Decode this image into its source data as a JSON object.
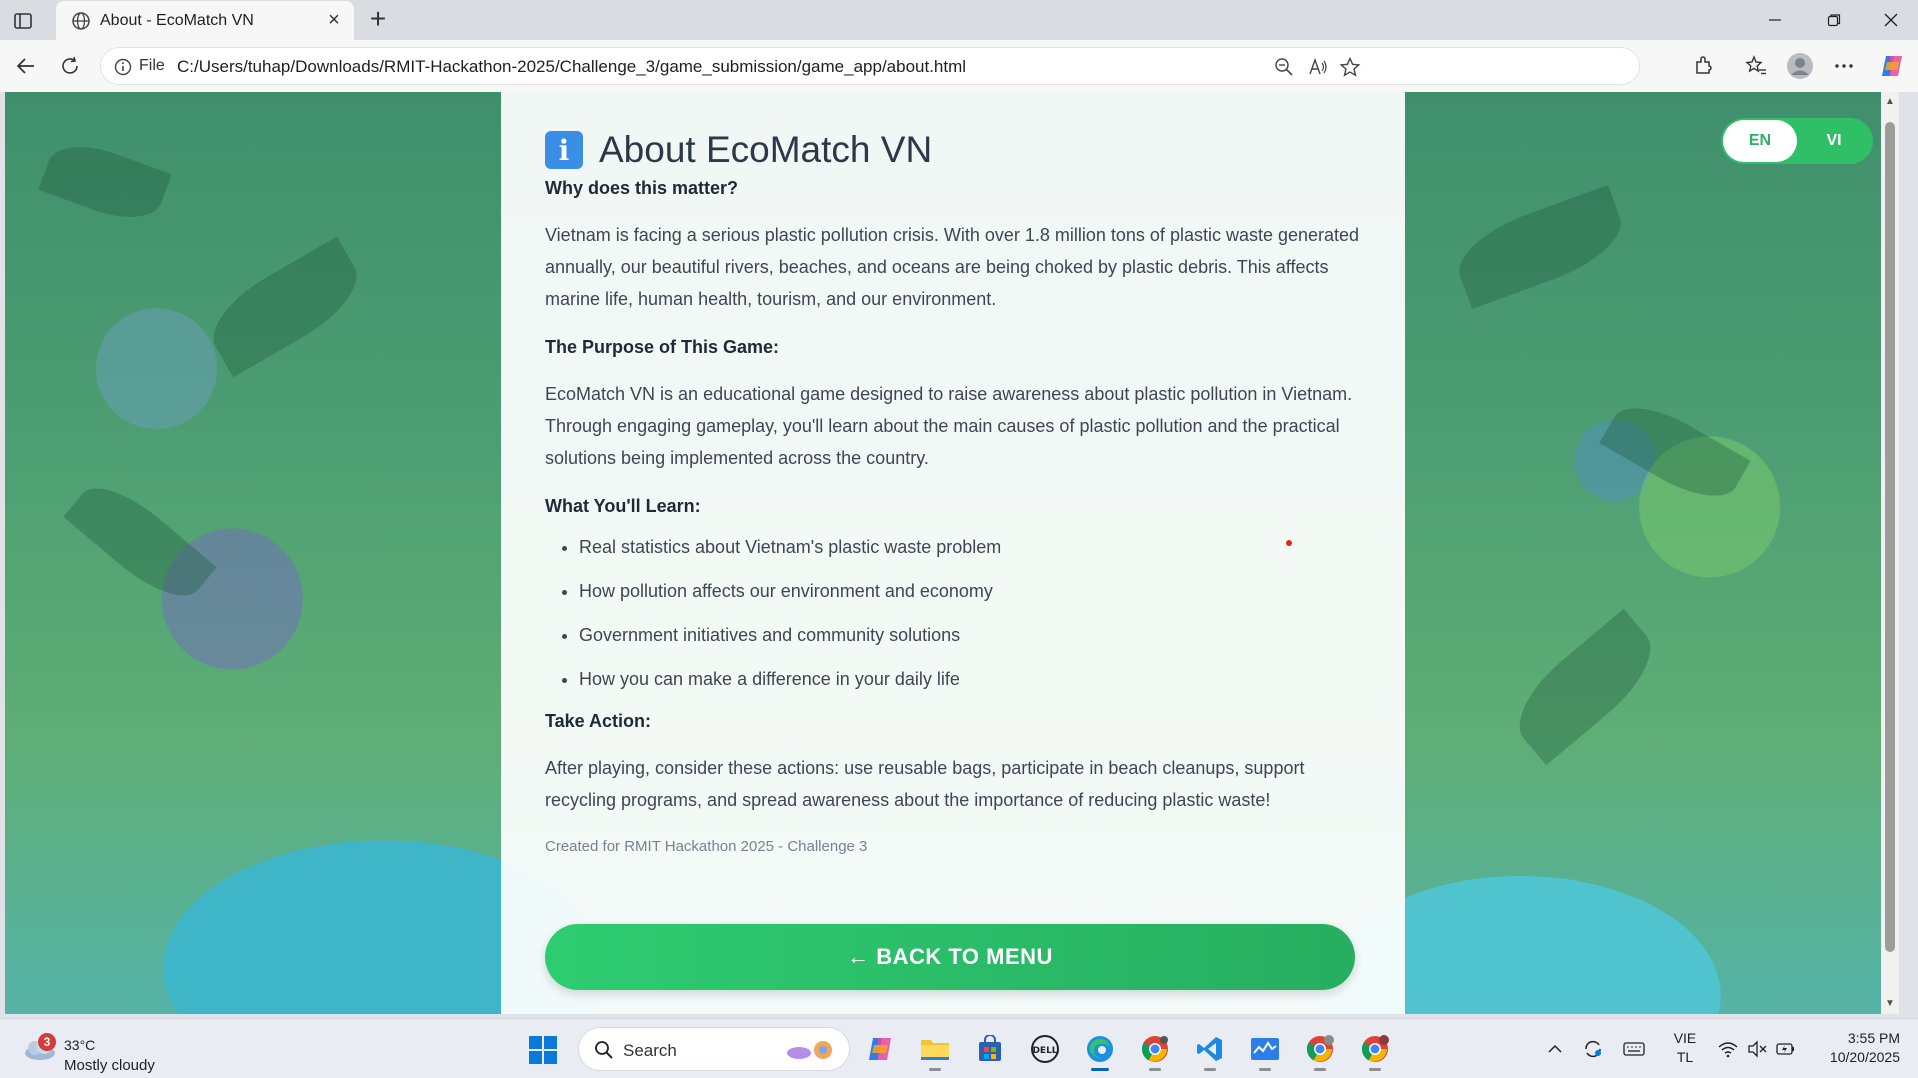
{
  "browser": {
    "tab_title": "About - EcoMatch VN",
    "address_scheme": "File",
    "address_url": "C:/Users/tuhap/Downloads/RMIT-Hackathon-2025/Challenge_3/game_submission/game_app/about.html"
  },
  "page": {
    "lang_toggle": {
      "en": "EN",
      "vi": "VI",
      "active": "EN"
    },
    "title_icon": "information-icon",
    "title": "About EcoMatch VN",
    "section_why_heading": "Why does this matter?",
    "section_why_text": "Vietnam is facing a serious plastic pollution crisis. With over 1.8 million tons of plastic waste generated annually, our beautiful rivers, beaches, and oceans are being choked by plastic debris. This affects marine life, human health, tourism, and our environment.",
    "section_purpose_heading": "The Purpose of This Game:",
    "section_purpose_text": "EcoMatch VN is an educational game designed to raise awareness about plastic pollution in Vietnam. Through engaging gameplay, you'll learn about the main causes of plastic pollution and the practical solutions being implemented across the country.",
    "section_learn_heading": "What You'll Learn:",
    "learn_items": [
      "Real statistics about Vietnam's plastic waste problem",
      "How pollution affects our environment and economy",
      "Government initiatives and community solutions",
      "How you can make a difference in your daily life"
    ],
    "section_action_heading": "Take Action:",
    "section_action_text": "After playing, consider these actions: use reusable bags, participate in beach cleanups, support recycling programs, and spread awareness about the importance of reducing plastic waste!",
    "credit": "Created for RMIT Hackathon 2025 - Challenge 3",
    "back_button": "← BACK TO MENU",
    "accent_color": "#2ecc71"
  },
  "taskbar": {
    "weather_badge": "3",
    "weather_temp": "33°C",
    "weather_condition": "Mostly cloudy",
    "search_label": "Search",
    "input_lang_top": "VIE",
    "input_lang_bottom": "TL",
    "time": "3:55 PM",
    "date": "10/20/2025"
  }
}
